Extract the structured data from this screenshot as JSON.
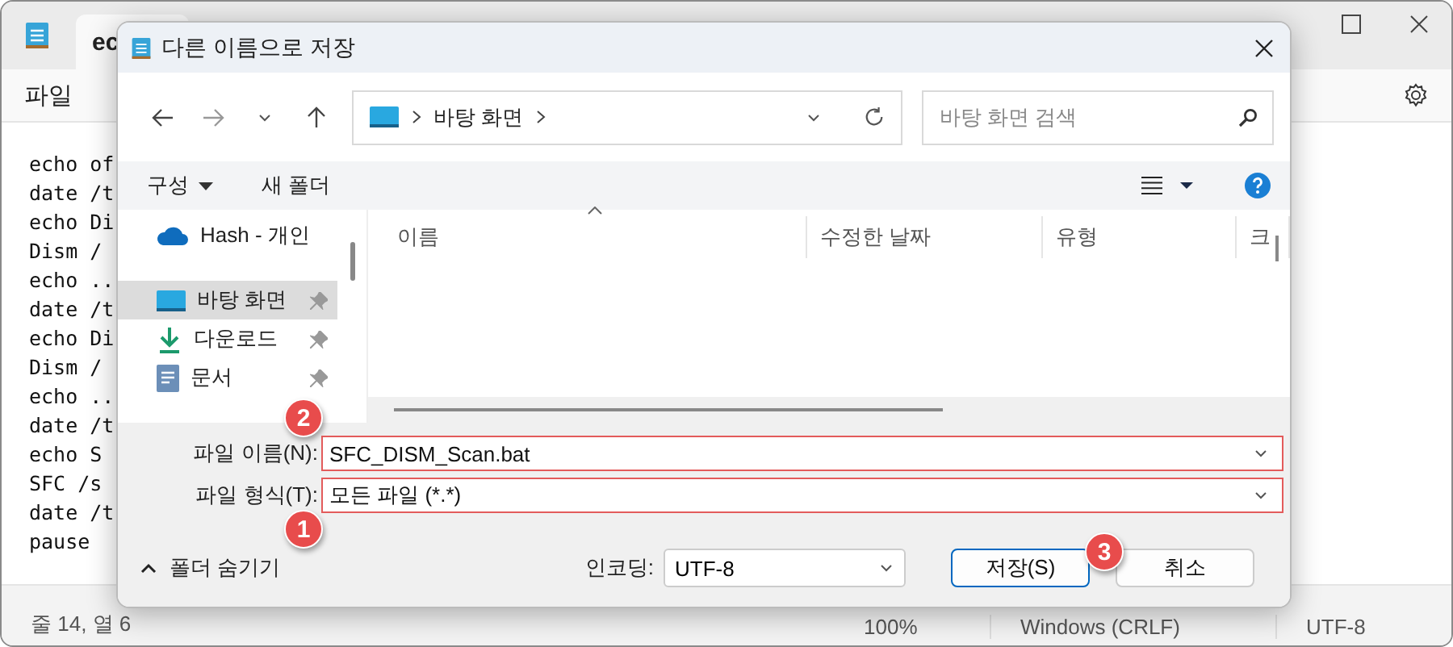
{
  "notepad": {
    "tab_title": "ec",
    "menu": [
      "파일"
    ],
    "lines": [
      "echo of",
      "date /t",
      "echo Di",
      "Dism /",
      "echo ..",
      "date /t",
      "echo Di",
      "Dism /",
      "echo ..",
      "date /t",
      "echo S",
      "SFC /s",
      "date /t",
      "pause"
    ],
    "status_bar": [
      "줄 14, 열 6",
      "100%",
      "Windows (CRLF)",
      "UTF-8"
    ]
  },
  "dialog": {
    "title": "다른 이름으로 저장",
    "address": [
      "바탕 화면"
    ],
    "search": {
      "placeholder": "바탕 화면 검색"
    },
    "toolbar": {
      "organize": "구성",
      "new_folder": "새 폴더"
    },
    "nav_items": [
      {
        "label": "Hash - 개인",
        "kind": "cloud",
        "selected": false,
        "pinned": false
      },
      {
        "label": "바탕 화면",
        "kind": "desktop",
        "selected": true,
        "pinned": true
      },
      {
        "label": "다운로드",
        "kind": "download",
        "selected": false,
        "pinned": true
      },
      {
        "label": "문서",
        "kind": "document",
        "selected": false,
        "pinned": true
      }
    ],
    "columns": [
      "이름",
      "수정한 날짜",
      "유형",
      "크"
    ],
    "file_name": {
      "label": "파일 이름(N):",
      "value": "SFC_DISM_Scan.bat",
      "highlighted": true
    },
    "file_type": {
      "label": "파일 형식(T):",
      "value": "모든 파일  (*.*)",
      "highlighted": true
    },
    "hide_folders": "폴더 숨기기",
    "encoding": {
      "label": "인코딩:",
      "value": "UTF-8"
    },
    "buttons": [
      {
        "label": "저장(S)",
        "default": true
      },
      {
        "label": "취소",
        "default": false
      }
    ]
  },
  "annotations": [
    {
      "number": "2"
    },
    {
      "number": "1"
    },
    {
      "number": "3"
    }
  ]
}
